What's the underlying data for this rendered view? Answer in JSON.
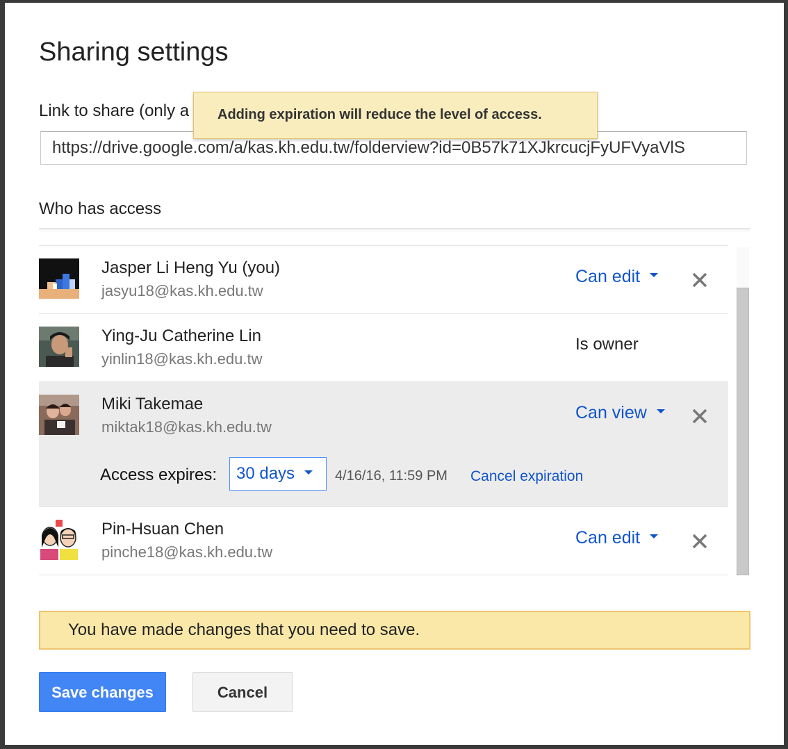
{
  "dialog": {
    "title": "Sharing settings",
    "link_label": "Link to share (only a",
    "link_url": "https://drive.google.com/a/kas.kh.edu.tw/folderview?id=0B57k71XJkrcucjFyUFVyaVlS",
    "tooltip": "Adding expiration will reduce the level of access.",
    "who_label": "Who has access"
  },
  "people": [
    {
      "name": "Jasper Li Heng Yu (you)",
      "email": "jasyu18@kas.kh.edu.tw",
      "permission": "Can edit",
      "avatar_icon": "pixel-avatar-icon"
    },
    {
      "name": "Ying-Ju Catherine Lin",
      "email": "yinlin18@kas.kh.edu.tw",
      "permission": "Is owner",
      "avatar_icon": "photo-avatar-icon"
    },
    {
      "name": "Miki Takemae",
      "email": "miktak18@kas.kh.edu.tw",
      "permission": "Can view",
      "avatar_icon": "photo-avatar-icon",
      "expiration": {
        "label": "Access expires:",
        "value": "30 days",
        "date": "4/16/16, 11:59 PM",
        "cancel": "Cancel expiration"
      }
    },
    {
      "name": "Pin-Hsuan Chen",
      "email": "pinche18@kas.kh.edu.tw",
      "permission": "Can edit",
      "avatar_icon": "cartoon-avatar-icon"
    }
  ],
  "notice": "You have made changes that you need to save.",
  "buttons": {
    "save": "Save changes",
    "cancel": "Cancel"
  },
  "colors": {
    "link_blue": "#1155cc",
    "save_blue": "#4285f4",
    "notice_yellow": "#f9e8a8",
    "tooltip_yellow": "#f9edbe"
  }
}
